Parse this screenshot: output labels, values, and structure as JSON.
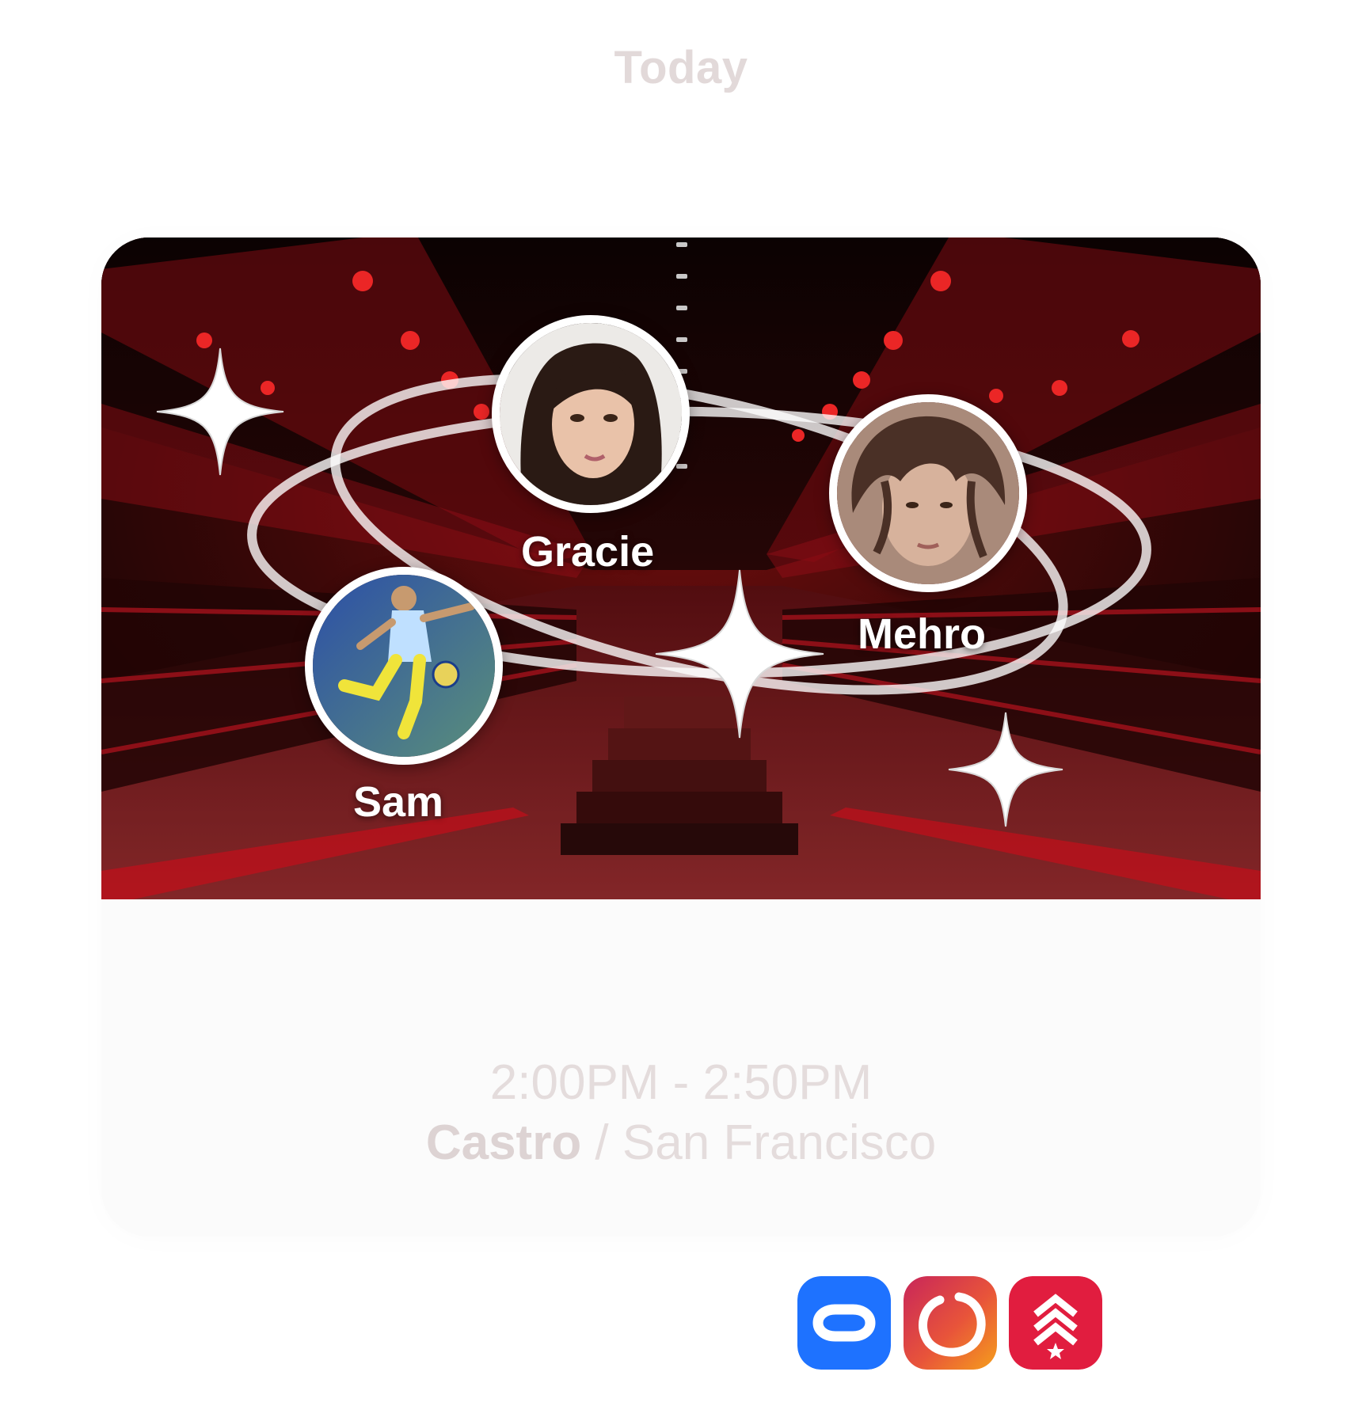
{
  "header": {
    "day": "Today"
  },
  "card": {
    "friends": [
      {
        "name": "Gracie"
      },
      {
        "name": "Mehro"
      },
      {
        "name": "Sam"
      }
    ],
    "time": "2:00PM - 2:50PM",
    "studio": "Castro",
    "separator": " / ",
    "city": "San Francisco"
  },
  "apps": [
    {
      "name": "link-app-icon",
      "color": "#1e72ff"
    },
    {
      "name": "ring-app-icon",
      "color": "#e8543a"
    },
    {
      "name": "chevron-star-app-icon",
      "color": "#e11d3f"
    }
  ],
  "colors": {
    "hero_red": "#c8101e",
    "muted_text": "#e2d9d9"
  }
}
